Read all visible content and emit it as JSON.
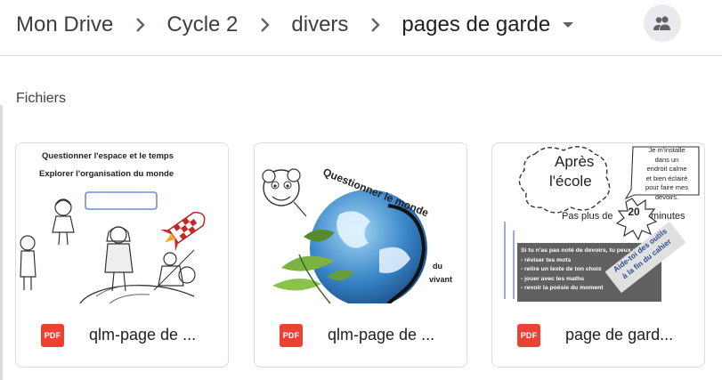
{
  "breadcrumb": {
    "items": [
      "Mon Drive",
      "Cycle 2",
      "divers",
      "pages de garde"
    ]
  },
  "section": {
    "title": "Fichiers"
  },
  "files": [
    {
      "name": "qlm-page de ...",
      "type_badge": "PDF",
      "thumb": {
        "line1": "Questionner l'espace et le temps",
        "line2": "Explorer l'organisation du monde"
      }
    },
    {
      "name": "qlm-page de ...",
      "type_badge": "PDF",
      "thumb": {
        "arc": "Questionner le monde",
        "du": "du",
        "vivant": "vivant"
      }
    },
    {
      "name": "page de gard...",
      "type_badge": "PDF",
      "thumb": {
        "apres": "Après",
        "ecole": "l'école",
        "install": [
          "Je m'installe",
          "dans un",
          "endroit calme",
          "et bien éclairé",
          "pour faire mes",
          "devoirs."
        ],
        "pas_plus": "Pas plus de",
        "num": "20",
        "minutes": "minutes",
        "box": [
          "Si tu n'as pas noté de devoirs, tu peux :",
          "- réviser tes mots",
          "- relire un texte de ton choix",
          "- jouer avec les maths",
          "- revoir la poésie du moment"
        ],
        "aide1": "Aide-toi des outils",
        "aide2": "à la fin du cahier"
      }
    }
  ],
  "colors": {
    "pdf_red": "#ea4335",
    "border": "#dadce0",
    "text": "#202124"
  }
}
